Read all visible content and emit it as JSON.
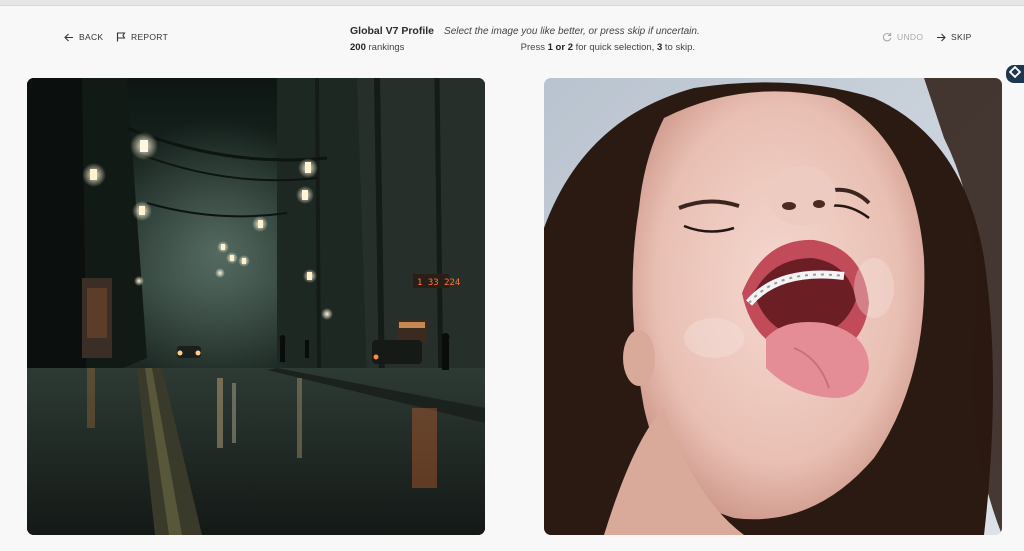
{
  "nav": {
    "back_label": "BACK",
    "report_label": "REPORT",
    "undo_label": "UNDO",
    "skip_label": "SKIP"
  },
  "header": {
    "profile_title": "Global V7 Profile",
    "instruction": "Select the image you like better, or press skip if uncertain.",
    "rankings_count": "200",
    "rankings_label": "rankings",
    "shortcut": {
      "press": "Press",
      "key_one": "1",
      "or": "or",
      "key_two": "2",
      "quick_selection": "for quick selection,",
      "key_skip": "3",
      "to_skip": "to skip."
    }
  },
  "images": {
    "left_sign_text": "1 33 224"
  },
  "icons": {
    "back": "arrow-left-icon",
    "report": "flag-icon",
    "undo": "refresh-icon",
    "skip": "arrow-right-icon",
    "side_badge": "diamond-icon"
  },
  "colors": {
    "page_background": "#f8f8f8",
    "text": "#2a2a2a",
    "disabled_text": "#a8a8a8",
    "side_badge": "#1f3550"
  }
}
